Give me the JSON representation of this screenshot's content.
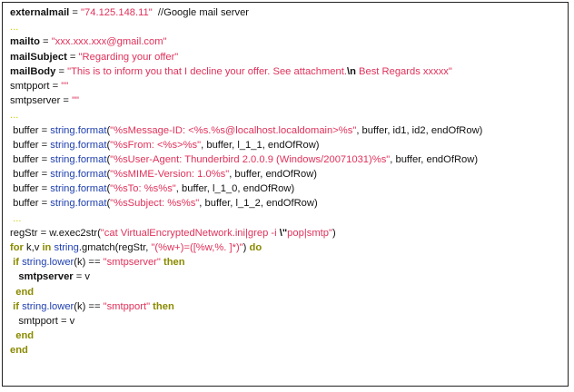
{
  "lines": [
    [
      {
        "t": "externalmail",
        "k": "k"
      },
      {
        "t": " = ",
        "k": "p"
      },
      {
        "t": "\"74.125.148.11\"",
        "k": "s"
      },
      {
        "t": "  //Google mail server",
        "k": "c"
      }
    ],
    [
      {
        "t": "...",
        "k": "g"
      }
    ],
    [
      {
        "t": "mailto",
        "k": "k"
      },
      {
        "t": " = ",
        "k": "p"
      },
      {
        "t": "\"xxx.xxx.xxx@gmail.com\"",
        "k": "s"
      }
    ],
    [
      {
        "t": "mailSubject",
        "k": "k"
      },
      {
        "t": " = ",
        "k": "p"
      },
      {
        "t": "\"Regarding your offer\"",
        "k": "s"
      }
    ],
    [
      {
        "t": "mailBody",
        "k": "k"
      },
      {
        "t": " = ",
        "k": "p"
      },
      {
        "t": "\"This is to inform you that I decline your offer. See attachment.",
        "k": "s"
      },
      {
        "t": "\\n",
        "k": "e"
      },
      {
        "t": " Best Regards xxxxx\"",
        "k": "s"
      }
    ],
    [
      {
        "t": "smtpport",
        "k": "p"
      },
      {
        "t": " = ",
        "k": "p"
      },
      {
        "t": "\"\"",
        "k": "s"
      }
    ],
    [
      {
        "t": "smtpserver",
        "k": "p"
      },
      {
        "t": " = ",
        "k": "p"
      },
      {
        "t": "\"\"",
        "k": "s"
      }
    ],
    [
      {
        "t": "...",
        "k": "g"
      }
    ],
    [
      {
        "t": " buffer = ",
        "k": "p"
      },
      {
        "t": "string.format",
        "k": "b"
      },
      {
        "t": "(",
        "k": "p"
      },
      {
        "t": "\"%sMessage-ID: <%s.%s@localhost.localdomain>%s\"",
        "k": "s"
      },
      {
        "t": ", buffer, id1, id2, endOfRow)",
        "k": "p"
      }
    ],
    [
      {
        "t": " buffer = ",
        "k": "p"
      },
      {
        "t": "string.format",
        "k": "b"
      },
      {
        "t": "(",
        "k": "p"
      },
      {
        "t": "\"%sFrom: <%s>%s\"",
        "k": "s"
      },
      {
        "t": ", buffer, l_1_1, endOfRow)",
        "k": "p"
      }
    ],
    [
      {
        "t": " buffer = ",
        "k": "p"
      },
      {
        "t": "string.format",
        "k": "b"
      },
      {
        "t": "(",
        "k": "p"
      },
      {
        "t": "\"%sUser-Agent: Thunderbird 2.0.0.9 (Windows/20071031)%s\"",
        "k": "s"
      },
      {
        "t": ", buffer, endOfRow)",
        "k": "p"
      }
    ],
    [
      {
        "t": " buffer = ",
        "k": "p"
      },
      {
        "t": "string.format",
        "k": "b"
      },
      {
        "t": "(",
        "k": "p"
      },
      {
        "t": "\"%sMIME-Version: 1.0%s\"",
        "k": "s"
      },
      {
        "t": ", buffer, endOfRow)",
        "k": "p"
      }
    ],
    [
      {
        "t": " buffer = ",
        "k": "p"
      },
      {
        "t": "string.format",
        "k": "b"
      },
      {
        "t": "(",
        "k": "p"
      },
      {
        "t": "\"%sTo: %s%s\"",
        "k": "s"
      },
      {
        "t": ", buffer, l_1_0, endOfRow)",
        "k": "p"
      }
    ],
    [
      {
        "t": " buffer = ",
        "k": "p"
      },
      {
        "t": "string.format",
        "k": "b"
      },
      {
        "t": "(",
        "k": "p"
      },
      {
        "t": "\"%sSubject: %s%s\"",
        "k": "s"
      },
      {
        "t": ", buffer, l_1_2, endOfRow)",
        "k": "p"
      }
    ],
    [
      {
        "t": " ...",
        "k": "g"
      }
    ],
    [
      {
        "t": "regStr = w.exec2str(",
        "k": "p"
      },
      {
        "t": "\"cat VirtualEncryptedNetwork.ini|grep -i ",
        "k": "s"
      },
      {
        "t": "\\\"",
        "k": "e"
      },
      {
        "t": "pop|smtp\"",
        "k": "s"
      },
      {
        "t": ")",
        "k": "p"
      }
    ],
    [
      {
        "t": "for",
        "k": "y"
      },
      {
        "t": " k,v ",
        "k": "p"
      },
      {
        "t": "in",
        "k": "y"
      },
      {
        "t": " ",
        "k": "p"
      },
      {
        "t": "string",
        "k": "b"
      },
      {
        "t": ".gmatch(regStr, ",
        "k": "p"
      },
      {
        "t": "\"(%w+)=([%w,%. ]*)\"",
        "k": "s"
      },
      {
        "t": ") ",
        "k": "p"
      },
      {
        "t": "do",
        "k": "y"
      }
    ],
    [
      {
        "t": " if",
        "k": "y"
      },
      {
        "t": " ",
        "k": "p"
      },
      {
        "t": "string.lower",
        "k": "b"
      },
      {
        "t": "(k) == ",
        "k": "p"
      },
      {
        "t": "\"smtpserver\"",
        "k": "s"
      },
      {
        "t": " then",
        "k": "y"
      }
    ],
    [
      {
        "t": "   smtpserver",
        "k": "k"
      },
      {
        "t": " = v",
        "k": "p"
      }
    ],
    [
      {
        "t": "  end",
        "k": "y"
      }
    ],
    [
      {
        "t": " if",
        "k": "y"
      },
      {
        "t": " ",
        "k": "p"
      },
      {
        "t": "string.lower",
        "k": "b"
      },
      {
        "t": "(k) == ",
        "k": "p"
      },
      {
        "t": "\"smtpport\"",
        "k": "s"
      },
      {
        "t": " then",
        "k": "y"
      }
    ],
    [
      {
        "t": "   smtpport = v",
        "k": "p"
      }
    ],
    [
      {
        "t": "  end",
        "k": "y"
      }
    ],
    [
      {
        "t": "end",
        "k": "y"
      }
    ]
  ],
  "colors": {
    "string": "#e0315a",
    "builtin": "#1f3fae",
    "keyword": "#8a8a00",
    "ellipsis": "#d0d000",
    "text": "#111111",
    "border": "#222222"
  }
}
